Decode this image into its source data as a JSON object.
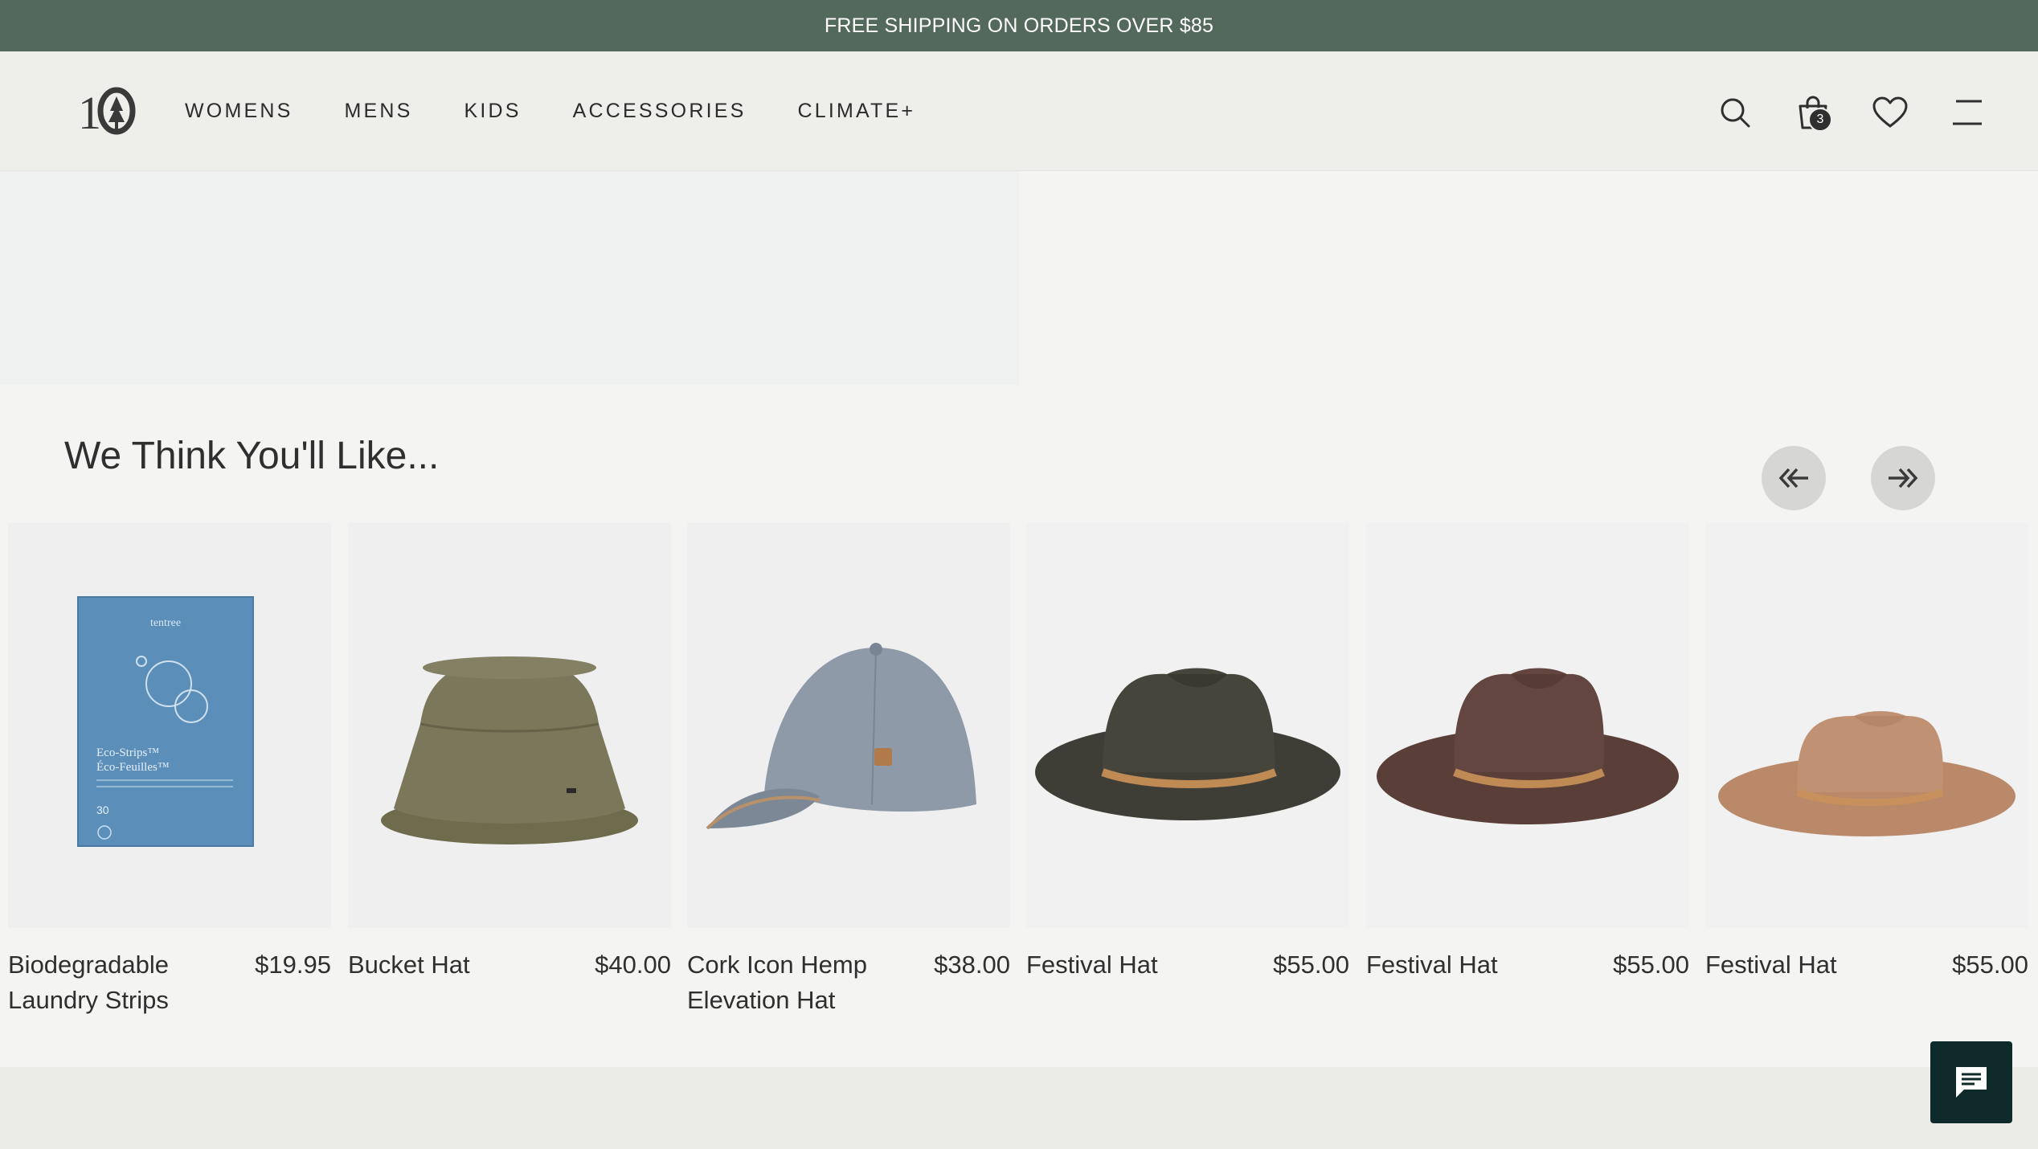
{
  "promo": {
    "text": "FREE SHIPPING ON ORDERS OVER $85"
  },
  "header": {
    "logo_alt": "tentree",
    "nav": [
      "WOMENS",
      "MENS",
      "KIDS",
      "ACCESSORIES",
      "CLIMATE+"
    ],
    "icons": [
      "search-icon",
      "bag-icon",
      "heart-icon",
      "menu-icon"
    ],
    "cart_count": "3"
  },
  "recommendations": {
    "title": "We Think You'll Like...",
    "prev_icon": "double-chevron-left-icon",
    "next_icon": "double-chevron-right-icon",
    "products": [
      {
        "name": "Biodegradable Laundry Strips",
        "price": "$19.95",
        "image": "laundry-strips-box",
        "box_brand": "tentree",
        "box_title": "Eco-Strips™",
        "box_title_fr": "Éco-Feuilles™",
        "box_count": "30"
      },
      {
        "name": "Bucket Hat",
        "price": "$40.00",
        "image": "olive-bucket-hat"
      },
      {
        "name": "Cork Icon Hemp Elevation Hat",
        "price": "$38.00",
        "image": "gray-baseball-cap"
      },
      {
        "name": "Festival Hat",
        "price": "$55.00",
        "image": "dark-green-fedora"
      },
      {
        "name": "Festival Hat",
        "price": "$55.00",
        "image": "brown-fedora"
      },
      {
        "name": "Festival Hat",
        "price": "$55.00",
        "image": "tan-fedora"
      }
    ]
  },
  "chat": {
    "icon": "chat-icon"
  },
  "colors": {
    "promo_bg": "#52695c",
    "header_bg": "#eeeeeb",
    "chat_bg": "#0f2a2a"
  }
}
